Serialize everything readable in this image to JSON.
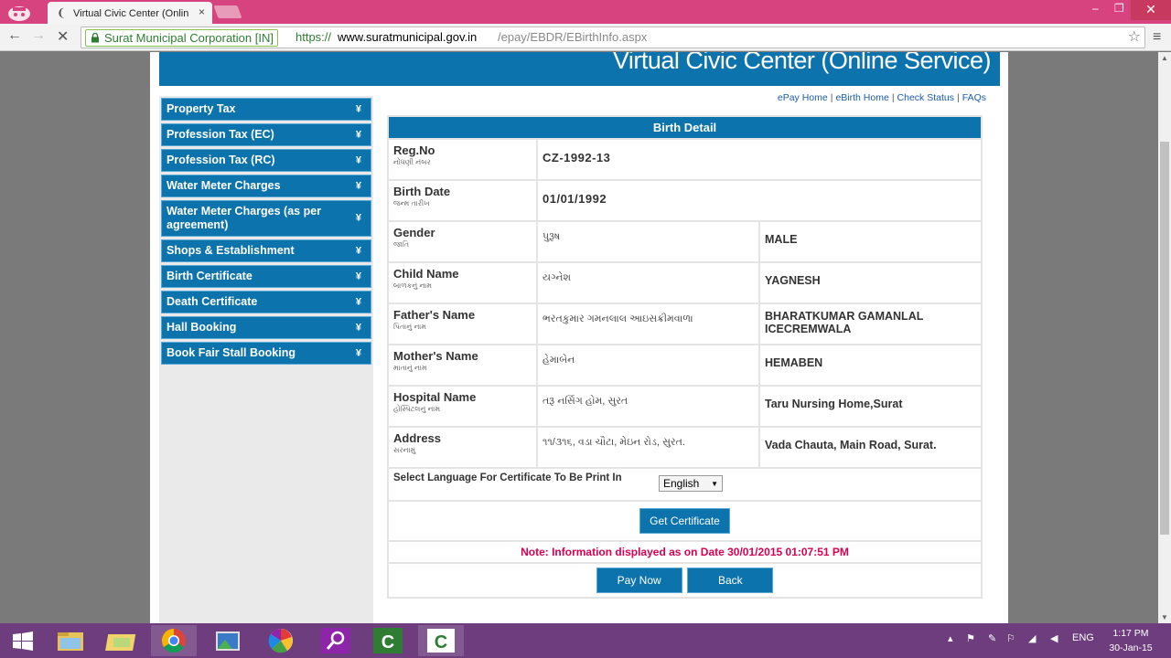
{
  "browser": {
    "tab_title": "Virtual Civic Center (Onlin",
    "tab_favicon": "loading-spinner-icon",
    "ev_badge": "Surat Municipal Corporation [IN]",
    "url_scheme": "https://",
    "url_domain": "www.suratmunicipal.gov.in",
    "url_path": "/epay/EBDR/EBirthInfo.aspx"
  },
  "site": {
    "title": "Virtual Civic Center (Online Service)"
  },
  "sidebar": {
    "items": [
      {
        "label": "Property Tax"
      },
      {
        "label": "Profession Tax (EC)"
      },
      {
        "label": "Profession Tax (RC)"
      },
      {
        "label": "Water Meter Charges"
      },
      {
        "label": "Water Meter Charges (as per agreement)"
      },
      {
        "label": "Shops & Establishment"
      },
      {
        "label": "Birth Certificate"
      },
      {
        "label": "Death Certificate"
      },
      {
        "label": "Hall Booking"
      },
      {
        "label": "Book Fair Stall Booking"
      }
    ]
  },
  "toplinks": [
    "ePay Home",
    "eBirth Home",
    "Check Status",
    "FAQs"
  ],
  "detail": {
    "heading": "Birth Detail",
    "reg_no": {
      "label": "Reg.No",
      "label_gu": "નોંધણી નંબર",
      "value": "CZ-1992-13"
    },
    "birth_date": {
      "label": "Birth Date",
      "label_gu": "જન્મ તારીખ",
      "value": "01/01/1992"
    },
    "gender": {
      "label": "Gender",
      "label_gu": "જાતિ",
      "value_gu": "પુરૂષ",
      "value_en": "MALE"
    },
    "child_name": {
      "label": "Child Name",
      "label_gu": "બાળકનું નામ",
      "value_gu": "યગ્નેશ",
      "value_en": "YAGNESH"
    },
    "father_name": {
      "label": "Father's Name",
      "label_gu": "પિતાનું નામ",
      "value_gu": "ભરતકુમાર ગમનલાલ આઇસક્રીમવાળા",
      "value_en": "BHARATKUMAR GAMANLAL ICECREMWALA"
    },
    "mother_name": {
      "label": "Mother's Name",
      "label_gu": "માતાનું નામ",
      "value_gu": "હેમાબેન",
      "value_en": "HEMABEN"
    },
    "hospital_name": {
      "label": "Hospital Name",
      "label_gu": "હોસ્પિટલનું નામ",
      "value_gu": "તરૂ નર્સિંગ હોમ, સુરત",
      "value_en": "Taru Nursing Home,Surat"
    },
    "address": {
      "label": "Address",
      "label_gu": "સરનામું",
      "value_gu": "૧૧/૩૧૬, વડા ચૌટા, મેઇન રોડ, સુરત.",
      "value_en": "Vada Chauta, Main Road, Surat."
    },
    "language_label": "Select Language For Certificate To Be Print In",
    "language_selected": "English",
    "get_certificate": "Get Certificate",
    "note": "Note: Information displayed as on Date 30/01/2015 01:07:51 PM",
    "pay_now": "Pay Now",
    "back": "Back"
  },
  "taskbar": {
    "apps": [
      "windows-start-icon",
      "file-explorer-icon",
      "folder-icon",
      "chrome-icon",
      "photo-viewer-icon",
      "picasa-icon",
      "search-app-icon",
      "camtasia-recorder-icon",
      "camtasia-studio-icon"
    ],
    "lang": "ENG",
    "time": "1:17 PM",
    "date": "30-Jan-15"
  }
}
